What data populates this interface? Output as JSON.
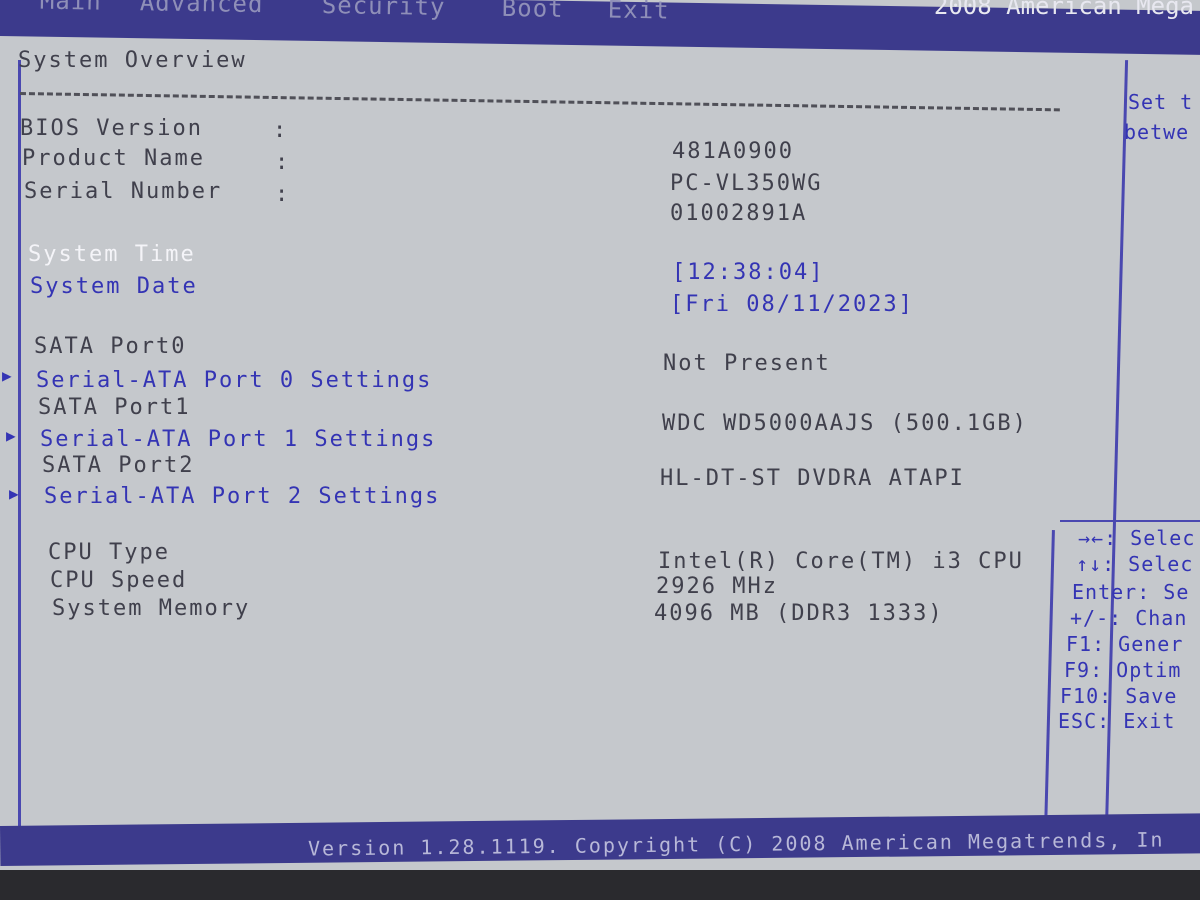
{
  "header": {
    "tabs": [
      "Main",
      "Advanced",
      "Security",
      "Boot",
      "Exit"
    ],
    "brand": "2008 American Mega"
  },
  "section_title": "System Overview",
  "info": [
    {
      "label": "BIOS Version",
      "sep": ":",
      "value": "481A0900"
    },
    {
      "label": "Product Name",
      "sep": ":",
      "value": "PC-VL350WG"
    },
    {
      "label": "Serial Number",
      "sep": ":",
      "value": "01002891A"
    }
  ],
  "system_time": {
    "label": "System Time",
    "value": "[12:38:04]"
  },
  "system_date": {
    "label": "System Date",
    "value": "[Fri 08/11/2023]"
  },
  "sata": [
    {
      "label": "SATA Port0",
      "value": "Not Present",
      "settings": "Serial-ATA Port 0 Settings"
    },
    {
      "label": "SATA Port1",
      "value": "WDC WD5000AAJS (500.1GB)",
      "settings": "Serial-ATA Port 1 Settings"
    },
    {
      "label": "SATA Port2",
      "value": "HL-DT-ST DVDRA ATAPI",
      "settings": "Serial-ATA Port 2 Settings"
    }
  ],
  "cpu": [
    {
      "label": "CPU Type",
      "value": "Intel(R) Core(TM) i3 CPU"
    },
    {
      "label": "CPU Speed",
      "value": "2926 MHz"
    },
    {
      "label": "System Memory",
      "value": "4096 MB (DDR3 1333)"
    }
  ],
  "help_top": [
    "Set t",
    "betwe"
  ],
  "help_keys": [
    "→←: Selec",
    "↑↓: Selec",
    "Enter: Se",
    "+/-: Chan",
    "F1: Gener",
    "F9: Optim",
    "F10: Save",
    "ESC: Exit"
  ],
  "footer": "Version 1.28.1119. Copyright (C) 2008 American Megatrends, In"
}
